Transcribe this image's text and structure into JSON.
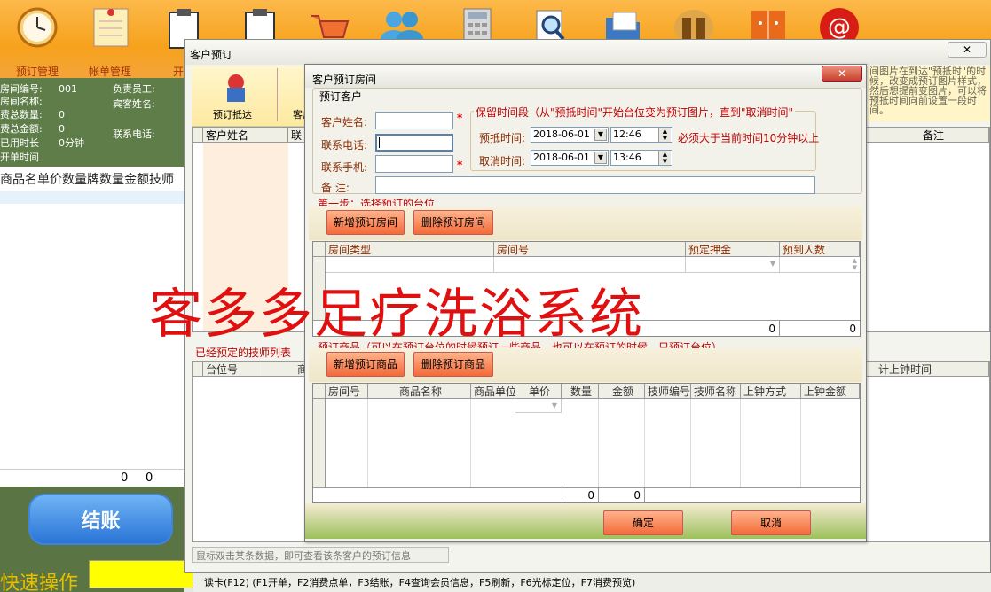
{
  "toolbar": {
    "labels": [
      "预订管理",
      "帐单管理",
      "开"
    ]
  },
  "room_info": {
    "room_no_label": "房间编号:",
    "room_no": "001",
    "room_name_label": "房间名称:",
    "count_label": "费总数量:",
    "count": "0",
    "amount_label": "费总金额:",
    "amount": "0",
    "used_label": "已用时长",
    "used": "0分钟",
    "open_label": "开单时间",
    "staff_label": "负责员工:",
    "guest_label": "宾客姓名:",
    "phone_label": "联系电话:"
  },
  "product_header": "商品名单价数量牌数量金额技师",
  "left_sum": {
    "a": "0",
    "b": "0"
  },
  "settle_label": "结账",
  "quick_label": "快速操作",
  "status_bar": "读卡(F12) (F1开单，F2消费点单，F3结账，F4查询会员信息，F5刷新，F6光标定位，F7消费预览)",
  "win1": {
    "title": "客户预订",
    "close": "✕",
    "tool_label": "预订抵达",
    "tool_label2": "客户",
    "right_note": "间图片在到达\"预抵时\"的时候，改变成预订图片样式，然后想提前变图片，可以将预抵时间向前设置一段时间。",
    "grid_col1": "客户姓名",
    "grid_col2": "联",
    "grid_col_note": "备注",
    "list_label": "已经预定的技师列表",
    "grid2_cols": [
      "台位号",
      "商品"
    ],
    "grid2_col_right": "计上钟时间",
    "footer": "鼠标双击某条数据，即可查看该条客户的预订信息"
  },
  "dialog": {
    "title": "客户预订房间",
    "close": "✕",
    "section_customer": "预订客户",
    "name_label": "客户姓名:",
    "phone_label": "联系电话:",
    "mobile_label": "联系手机:",
    "note_label": "备    注:",
    "keep_title": "保留时间段（从\"预抵时间\"开始台位变为预订图片，直到\"取消时间\"",
    "arrive_label": "预抵时间:",
    "arrive_date": "2018-06-01",
    "arrive_time": "12:46",
    "arrive_hint": "必须大于当前时间10分钟以上",
    "cancel_label": "取消时间:",
    "cancel_date": "2018-06-01",
    "cancel_time": "13:46",
    "step1": "第一步：选择预订的台位",
    "add_room": "新增预订房间",
    "del_room": "删除预订房间",
    "room_cols": [
      "房间类型",
      "房间号",
      "预定押金",
      "预到人数"
    ],
    "room_sum_a": "0",
    "room_sum_b": "0",
    "step2": "预订商品（可以在预订台位的时候预订一些商品，也可以在预订的时候，只预订台位）",
    "add_goods": "新增预订商品",
    "del_goods": "删除预订商品",
    "goods_cols": [
      "房间号",
      "商品名称",
      "商品单位",
      "单价",
      "数量",
      "金额",
      "技师编号",
      "技师名称",
      "上钟方式",
      "上钟金额"
    ],
    "goods_sum_qty": "0",
    "goods_sum_amt": "0",
    "ok": "确定",
    "cancel": "取消"
  },
  "watermark": "客多多足疗洗浴系统"
}
